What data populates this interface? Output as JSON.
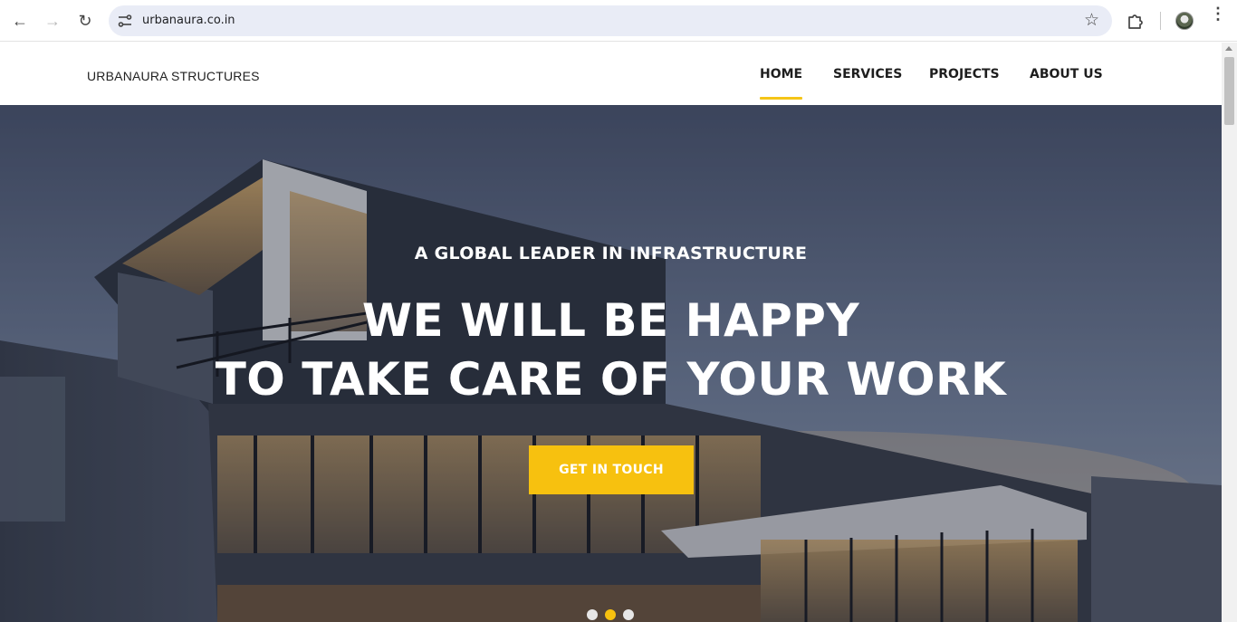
{
  "browser": {
    "url": "urbanaura.co.in",
    "back_icon": "←",
    "forward_icon": "→",
    "reload_icon": "↻",
    "star_icon": "☆",
    "menu_icon": "⋮"
  },
  "site": {
    "brand": "URBANAURA STRUCTURES",
    "nav": [
      {
        "label": "HOME",
        "active": true
      },
      {
        "label": "SERVICES",
        "active": false
      },
      {
        "label": "PROJECTS",
        "active": false
      },
      {
        "label": "ABOUT US",
        "active": false
      }
    ]
  },
  "hero": {
    "kicker": "A GLOBAL LEADER IN INFRASTRUCTURE",
    "headline_line1": "WE WILL BE HAPPY",
    "headline_line2": "TO TAKE CARE OF YOUR WORK",
    "cta_label": "GET IN TOUCH",
    "slides_total": 3,
    "active_slide": 2
  },
  "colors": {
    "accent": "#f7c10f",
    "nav_text": "#1e1e1e",
    "omnibox_bg": "#e9ecf6"
  }
}
